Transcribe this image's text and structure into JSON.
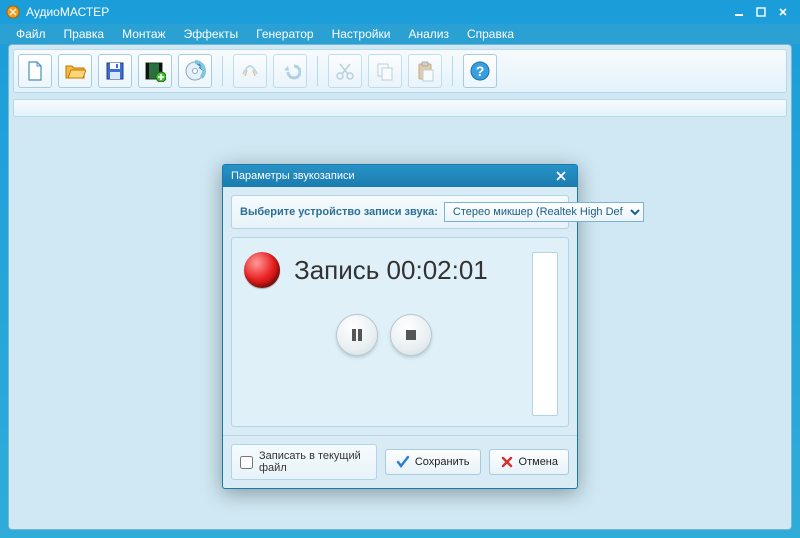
{
  "app": {
    "title": "АудиоМАСТЕР"
  },
  "menu": {
    "file": "Файл",
    "edit": "Правка",
    "montage": "Монтаж",
    "effects": "Эффекты",
    "generator": "Генератор",
    "settings": "Настройки",
    "analysis": "Анализ",
    "help": "Справка"
  },
  "toolbar_icons": {
    "new": "new-file-icon",
    "open": "open-folder-icon",
    "save": "save-icon",
    "add_video": "add-video-icon",
    "disc": "disc-icon",
    "trim": "trim-icon",
    "undo": "undo-icon",
    "cut": "scissors-icon",
    "copy": "copy-icon",
    "paste": "paste-icon",
    "help": "help-icon"
  },
  "dialog": {
    "title": "Параметры звукозаписи",
    "device_label": "Выберите устройство записи звука:",
    "device_selected": "Стерео микшер (Realtek High Def",
    "rec_label": "Запись",
    "rec_time": "00:02:01",
    "checkbox_label": "Записать в текущий файл",
    "checkbox_checked": false,
    "save_btn": "Сохранить",
    "cancel_btn": "Отмена"
  }
}
